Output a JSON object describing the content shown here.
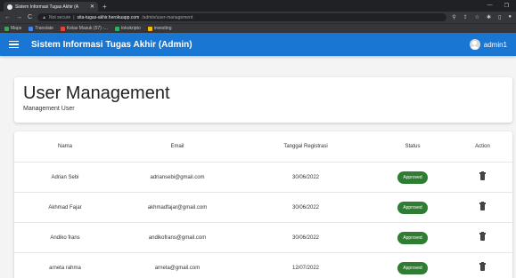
{
  "browser": {
    "tab_title": "Sistem Informasi Tugas Akhir (A",
    "url_scheme": "Not secure",
    "url_host": "sita-tugas-akhir.herokuapp.com",
    "url_path": "/admin/user-management",
    "bookmarks": [
      {
        "label": "Maps",
        "icon_color": "#34a853"
      },
      {
        "label": "Translate",
        "icon_color": "#4285f4"
      },
      {
        "label": "Kelas Masuk (57) -...",
        "icon_color": "#ea4335"
      },
      {
        "label": "tokokripto",
        "icon_color": "#1db954"
      },
      {
        "label": "investing",
        "icon_color": "#fbbc04"
      }
    ]
  },
  "app": {
    "title": "Sistem Informasi Tugas Akhir (Admin)",
    "username": "admin1",
    "accent_color": "#1976d2"
  },
  "page": {
    "title": "User Management",
    "subtitle": "Management User"
  },
  "table": {
    "columns": [
      "Nama",
      "Email",
      "Tanggal Registrasi",
      "Status",
      "Action"
    ],
    "rows": [
      {
        "nama": "Adrian Sebi",
        "email": "adriansebi@gmail.com",
        "tanggal": "30/06/2022",
        "status": "Approved"
      },
      {
        "nama": "Akhmad Fajar",
        "email": "akhmadfajar@gmail.com",
        "tanggal": "30/06/2022",
        "status": "Approved"
      },
      {
        "nama": "Andiko frans",
        "email": "andikofrans@gmail.com",
        "tanggal": "30/06/2022",
        "status": "Approved"
      },
      {
        "nama": "arneta rahma",
        "email": "arneta@gmail.com",
        "tanggal": "12/07/2022",
        "status": "Approved"
      }
    ],
    "status_color": "#2e7d32",
    "action_icon": "trash-icon"
  }
}
